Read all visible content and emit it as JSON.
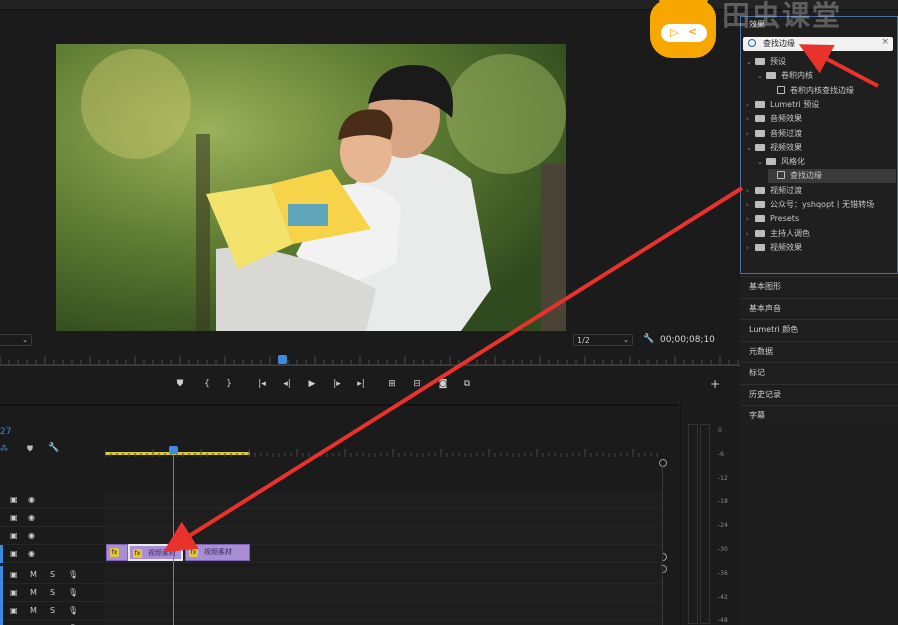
{
  "watermark": {
    "text": "田虫课堂"
  },
  "monitor": {
    "zoom_left": "",
    "resolution": "1/2",
    "timecode": "00;00;08;10"
  },
  "effects": {
    "title": "效果",
    "search_value": "查找边缘",
    "tree": [
      {
        "label": "预设",
        "level": 0,
        "open": true,
        "kind": "folder"
      },
      {
        "label": "卷积内核",
        "level": 1,
        "open": true,
        "kind": "folder"
      },
      {
        "label": "卷积内核查找边缘",
        "level": 2,
        "kind": "effect"
      },
      {
        "label": "Lumetri 预设",
        "level": 0,
        "kind": "folder"
      },
      {
        "label": "音频效果",
        "level": 0,
        "kind": "folder"
      },
      {
        "label": "音频过渡",
        "level": 0,
        "kind": "folder"
      },
      {
        "label": "视频效果",
        "level": 0,
        "open": true,
        "kind": "folder"
      },
      {
        "label": "风格化",
        "level": 1,
        "open": true,
        "kind": "folder"
      },
      {
        "label": "查找边缘",
        "level": 2,
        "kind": "effect",
        "selected": true
      },
      {
        "label": "视频过渡",
        "level": 0,
        "kind": "folder"
      },
      {
        "label": "公众号：yshqopt丨无错转场",
        "level": 0,
        "kind": "folder"
      },
      {
        "label": "Presets",
        "level": 0,
        "kind": "folder"
      },
      {
        "label": "主持人调色",
        "level": 0,
        "kind": "folder"
      },
      {
        "label": "视频效果",
        "level": 0,
        "kind": "folder"
      }
    ]
  },
  "panels": [
    "基本图形",
    "基本声音",
    "Lumetri 颜色",
    "元数据",
    "标记",
    "历史记录",
    "字幕"
  ],
  "timeline": {
    "timecode_frag": "27",
    "clips": [
      {
        "label": "视频素材"
      },
      {
        "label": "视频素材"
      }
    ],
    "track_letters": {
      "mute": "M",
      "solo": "S"
    }
  },
  "meter": {
    "labels": [
      "0",
      "-6",
      "-12",
      "-18",
      "-24",
      "-30",
      "-36",
      "-42",
      "-48"
    ]
  },
  "colors": {
    "accent_blue": "#3d8be0",
    "clip_purple": "#a98ed6",
    "arrow_red": "#e8322b",
    "logo_orange": "#f7a700"
  }
}
